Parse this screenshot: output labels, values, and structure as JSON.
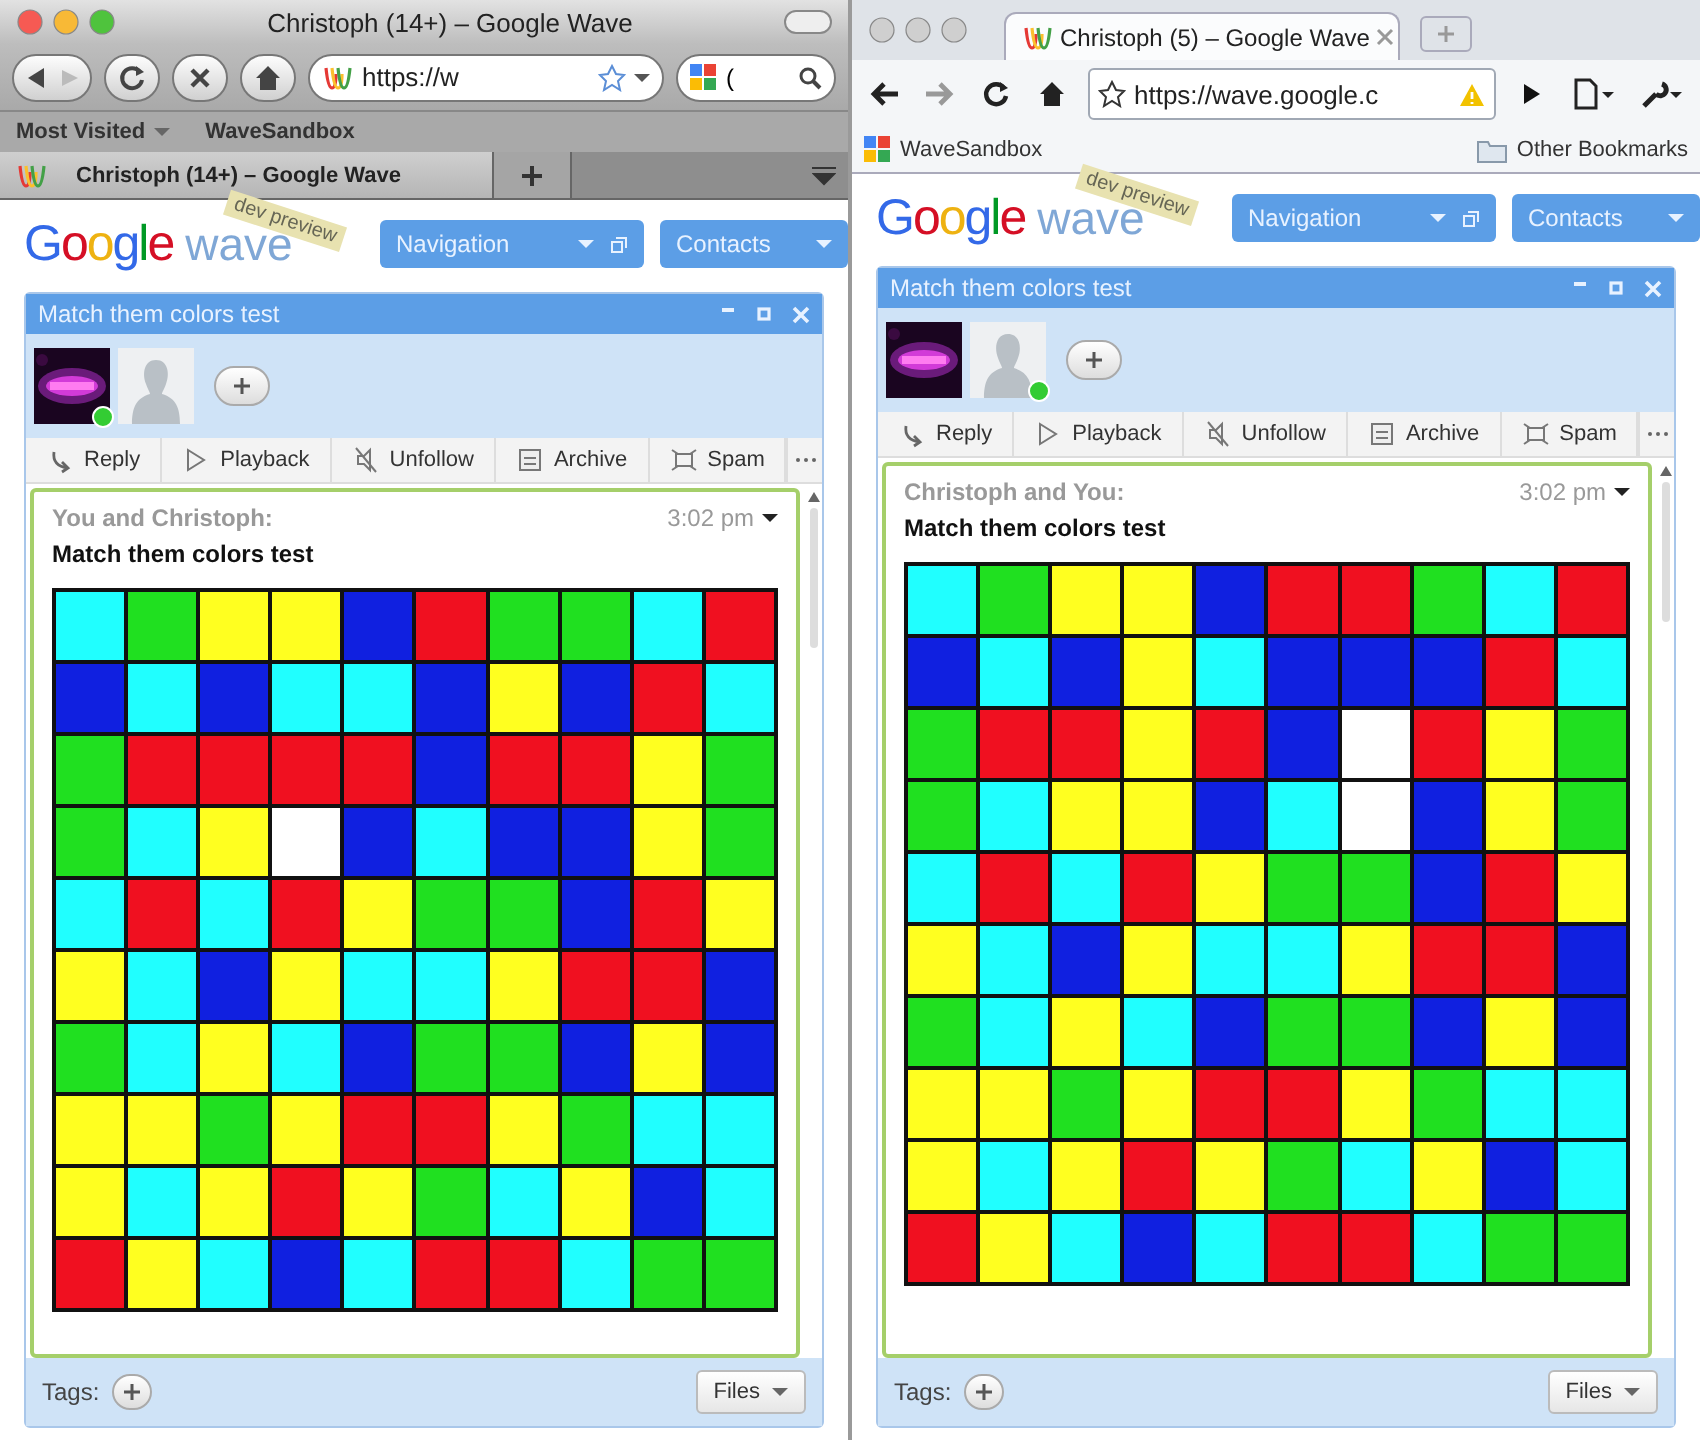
{
  "windows": [
    {
      "kind": "firefox",
      "focused": true,
      "title": "Christoph (14+) – Google Wave",
      "url": "https://w",
      "search": "(",
      "bookmarks": [
        {
          "kind": "menu",
          "label": "Most Visited"
        },
        {
          "kind": "link",
          "label": "WaveSandbox"
        }
      ],
      "tabs": [
        {
          "label": "Christoph (14+) – Google Wave",
          "selected": true
        }
      ],
      "wave": {
        "logo_word": "Google",
        "logo_product": "wave",
        "ribbon": "dev preview",
        "panels": [
          {
            "label": "Navigation",
            "popout": true
          },
          {
            "label": "Contacts",
            "popout": false
          }
        ],
        "title": "Match them colors test",
        "participants": [
          {
            "kind": "picture",
            "online": true
          },
          {
            "kind": "person",
            "online": false
          }
        ],
        "actions": [
          {
            "kind": "reply",
            "label": "Reply"
          },
          {
            "kind": "playback",
            "label": "Playback"
          },
          {
            "kind": "unfollow",
            "label": "Unfollow"
          },
          {
            "kind": "archive",
            "label": "Archive"
          },
          {
            "kind": "spam",
            "label": "Spam"
          }
        ],
        "blip": {
          "authors": "You and Christoph:",
          "time": "3:02 pm",
          "title": "Match them colors test",
          "grid": [
            {
              "cells": [
                {
                  "color": "#20ffff"
                },
                {
                  "color": "#20e020"
                },
                {
                  "color": "#ffff20"
                },
                {
                  "color": "#ffff20"
                },
                {
                  "color": "#1020e0"
                },
                {
                  "color": "#f01020"
                },
                {
                  "color": "#20e020"
                },
                {
                  "color": "#20e020"
                },
                {
                  "color": "#20ffff"
                },
                {
                  "color": "#f01020"
                }
              ]
            },
            {
              "cells": [
                {
                  "color": "#1020e0"
                },
                {
                  "color": "#20ffff"
                },
                {
                  "color": "#1020e0"
                },
                {
                  "color": "#20ffff"
                },
                {
                  "color": "#20ffff"
                },
                {
                  "color": "#1020e0"
                },
                {
                  "color": "#ffff20"
                },
                {
                  "color": "#1020e0"
                },
                {
                  "color": "#f01020"
                },
                {
                  "color": "#20ffff"
                }
              ]
            },
            {
              "cells": [
                {
                  "color": "#20e020"
                },
                {
                  "color": "#f01020"
                },
                {
                  "color": "#f01020"
                },
                {
                  "color": "#f01020"
                },
                {
                  "color": "#f01020"
                },
                {
                  "color": "#1020e0"
                },
                {
                  "color": "#f01020"
                },
                {
                  "color": "#f01020"
                },
                {
                  "color": "#ffff20"
                },
                {
                  "color": "#20e020"
                }
              ]
            },
            {
              "cells": [
                {
                  "color": "#20e020"
                },
                {
                  "color": "#20ffff"
                },
                {
                  "color": "#ffff20"
                },
                {
                  "color": "#ffffff"
                },
                {
                  "color": "#1020e0"
                },
                {
                  "color": "#20ffff"
                },
                {
                  "color": "#1020e0"
                },
                {
                  "color": "#1020e0"
                },
                {
                  "color": "#ffff20"
                },
                {
                  "color": "#20e020"
                }
              ]
            },
            {
              "cells": [
                {
                  "color": "#20ffff"
                },
                {
                  "color": "#f01020"
                },
                {
                  "color": "#20ffff"
                },
                {
                  "color": "#f01020"
                },
                {
                  "color": "#ffff20"
                },
                {
                  "color": "#20e020"
                },
                {
                  "color": "#20e020"
                },
                {
                  "color": "#1020e0"
                },
                {
                  "color": "#f01020"
                },
                {
                  "color": "#ffff20"
                }
              ]
            },
            {
              "cells": [
                {
                  "color": "#ffff20"
                },
                {
                  "color": "#20ffff"
                },
                {
                  "color": "#1020e0"
                },
                {
                  "color": "#ffff20"
                },
                {
                  "color": "#20ffff"
                },
                {
                  "color": "#20ffff"
                },
                {
                  "color": "#ffff20"
                },
                {
                  "color": "#f01020"
                },
                {
                  "color": "#f01020"
                },
                {
                  "color": "#1020e0"
                }
              ]
            },
            {
              "cells": [
                {
                  "color": "#20e020"
                },
                {
                  "color": "#20ffff"
                },
                {
                  "color": "#ffff20"
                },
                {
                  "color": "#20ffff"
                },
                {
                  "color": "#1020e0"
                },
                {
                  "color": "#20e020"
                },
                {
                  "color": "#20e020"
                },
                {
                  "color": "#1020e0"
                },
                {
                  "color": "#ffff20"
                },
                {
                  "color": "#1020e0"
                }
              ]
            },
            {
              "cells": [
                {
                  "color": "#ffff20"
                },
                {
                  "color": "#ffff20"
                },
                {
                  "color": "#20e020"
                },
                {
                  "color": "#ffff20"
                },
                {
                  "color": "#f01020"
                },
                {
                  "color": "#f01020"
                },
                {
                  "color": "#ffff20"
                },
                {
                  "color": "#20e020"
                },
                {
                  "color": "#20ffff"
                },
                {
                  "color": "#20ffff"
                }
              ]
            },
            {
              "cells": [
                {
                  "color": "#ffff20"
                },
                {
                  "color": "#20ffff"
                },
                {
                  "color": "#ffff20"
                },
                {
                  "color": "#f01020"
                },
                {
                  "color": "#ffff20"
                },
                {
                  "color": "#20e020"
                },
                {
                  "color": "#20ffff"
                },
                {
                  "color": "#ffff20"
                },
                {
                  "color": "#1020e0"
                },
                {
                  "color": "#20ffff"
                }
              ]
            },
            {
              "cells": [
                {
                  "color": "#f01020"
                },
                {
                  "color": "#ffff20"
                },
                {
                  "color": "#20ffff"
                },
                {
                  "color": "#1020e0"
                },
                {
                  "color": "#20ffff"
                },
                {
                  "color": "#f01020"
                },
                {
                  "color": "#f01020"
                },
                {
                  "color": "#20ffff"
                },
                {
                  "color": "#20e020"
                },
                {
                  "color": "#20e020"
                }
              ]
            }
          ]
        },
        "tags_label": "Tags:",
        "files": "Files"
      }
    },
    {
      "kind": "chrome",
      "focused": false,
      "url": "https://wave.google.c",
      "bookmarks": [
        {
          "kind": "site",
          "label": "WaveSandbox"
        },
        {
          "kind": "folder",
          "label": "Other Bookmarks"
        }
      ],
      "tabs": [
        {
          "label": "Christoph (5) – Google Wave",
          "selected": true
        }
      ],
      "wave": {
        "logo_word": "Google",
        "logo_product": "wave",
        "ribbon": "dev preview",
        "panels": [
          {
            "label": "Navigation",
            "popout": true
          },
          {
            "label": "Contacts",
            "popout": false
          }
        ],
        "title": "Match them colors test",
        "participants": [
          {
            "kind": "picture",
            "online": false
          },
          {
            "kind": "person",
            "online": true
          }
        ],
        "actions": [
          {
            "kind": "reply",
            "label": "Reply"
          },
          {
            "kind": "playback",
            "label": "Playback"
          },
          {
            "kind": "unfollow",
            "label": "Unfollow"
          },
          {
            "kind": "archive",
            "label": "Archive"
          },
          {
            "kind": "spam",
            "label": "Spam"
          }
        ],
        "blip": {
          "authors": "Christoph and You:",
          "time": "3:02 pm",
          "title": "Match them colors test",
          "grid": [
            {
              "cells": [
                {
                  "color": "#20ffff"
                },
                {
                  "color": "#20e020"
                },
                {
                  "color": "#ffff20"
                },
                {
                  "color": "#ffff20"
                },
                {
                  "color": "#1020e0"
                },
                {
                  "color": "#f01020"
                },
                {
                  "color": "#f01020"
                },
                {
                  "color": "#20e020"
                },
                {
                  "color": "#20ffff"
                },
                {
                  "color": "#f01020"
                }
              ]
            },
            {
              "cells": [
                {
                  "color": "#1020e0"
                },
                {
                  "color": "#20ffff"
                },
                {
                  "color": "#1020e0"
                },
                {
                  "color": "#ffff20"
                },
                {
                  "color": "#20ffff"
                },
                {
                  "color": "#1020e0"
                },
                {
                  "color": "#1020e0"
                },
                {
                  "color": "#1020e0"
                },
                {
                  "color": "#f01020"
                },
                {
                  "color": "#20ffff"
                }
              ]
            },
            {
              "cells": [
                {
                  "color": "#20e020"
                },
                {
                  "color": "#f01020"
                },
                {
                  "color": "#f01020"
                },
                {
                  "color": "#ffff20"
                },
                {
                  "color": "#f01020"
                },
                {
                  "color": "#1020e0"
                },
                {
                  "color": "#ffffff"
                },
                {
                  "color": "#f01020"
                },
                {
                  "color": "#ffff20"
                },
                {
                  "color": "#20e020"
                }
              ]
            },
            {
              "cells": [
                {
                  "color": "#20e020"
                },
                {
                  "color": "#20ffff"
                },
                {
                  "color": "#ffff20"
                },
                {
                  "color": "#ffff20"
                },
                {
                  "color": "#1020e0"
                },
                {
                  "color": "#20ffff"
                },
                {
                  "color": "#ffffff"
                },
                {
                  "color": "#1020e0"
                },
                {
                  "color": "#ffff20"
                },
                {
                  "color": "#20e020"
                }
              ]
            },
            {
              "cells": [
                {
                  "color": "#20ffff"
                },
                {
                  "color": "#f01020"
                },
                {
                  "color": "#20ffff"
                },
                {
                  "color": "#f01020"
                },
                {
                  "color": "#ffff20"
                },
                {
                  "color": "#20e020"
                },
                {
                  "color": "#20e020"
                },
                {
                  "color": "#1020e0"
                },
                {
                  "color": "#f01020"
                },
                {
                  "color": "#ffff20"
                }
              ]
            },
            {
              "cells": [
                {
                  "color": "#ffff20"
                },
                {
                  "color": "#20ffff"
                },
                {
                  "color": "#1020e0"
                },
                {
                  "color": "#ffff20"
                },
                {
                  "color": "#20ffff"
                },
                {
                  "color": "#20ffff"
                },
                {
                  "color": "#ffff20"
                },
                {
                  "color": "#f01020"
                },
                {
                  "color": "#f01020"
                },
                {
                  "color": "#1020e0"
                }
              ]
            },
            {
              "cells": [
                {
                  "color": "#20e020"
                },
                {
                  "color": "#20ffff"
                },
                {
                  "color": "#ffff20"
                },
                {
                  "color": "#20ffff"
                },
                {
                  "color": "#1020e0"
                },
                {
                  "color": "#20e020"
                },
                {
                  "color": "#20e020"
                },
                {
                  "color": "#1020e0"
                },
                {
                  "color": "#ffff20"
                },
                {
                  "color": "#1020e0"
                }
              ]
            },
            {
              "cells": [
                {
                  "color": "#ffff20"
                },
                {
                  "color": "#ffff20"
                },
                {
                  "color": "#20e020"
                },
                {
                  "color": "#ffff20"
                },
                {
                  "color": "#f01020"
                },
                {
                  "color": "#f01020"
                },
                {
                  "color": "#ffff20"
                },
                {
                  "color": "#20e020"
                },
                {
                  "color": "#20ffff"
                },
                {
                  "color": "#20ffff"
                }
              ]
            },
            {
              "cells": [
                {
                  "color": "#ffff20"
                },
                {
                  "color": "#20ffff"
                },
                {
                  "color": "#ffff20"
                },
                {
                  "color": "#f01020"
                },
                {
                  "color": "#ffff20"
                },
                {
                  "color": "#20e020"
                },
                {
                  "color": "#20ffff"
                },
                {
                  "color": "#ffff20"
                },
                {
                  "color": "#1020e0"
                },
                {
                  "color": "#20ffff"
                }
              ]
            },
            {
              "cells": [
                {
                  "color": "#f01020"
                },
                {
                  "color": "#ffff20"
                },
                {
                  "color": "#20ffff"
                },
                {
                  "color": "#1020e0"
                },
                {
                  "color": "#20ffff"
                },
                {
                  "color": "#f01020"
                },
                {
                  "color": "#f01020"
                },
                {
                  "color": "#20ffff"
                },
                {
                  "color": "#20e020"
                },
                {
                  "color": "#20e020"
                }
              ]
            }
          ]
        },
        "tags_label": "Tags:",
        "files": "Files"
      }
    }
  ]
}
